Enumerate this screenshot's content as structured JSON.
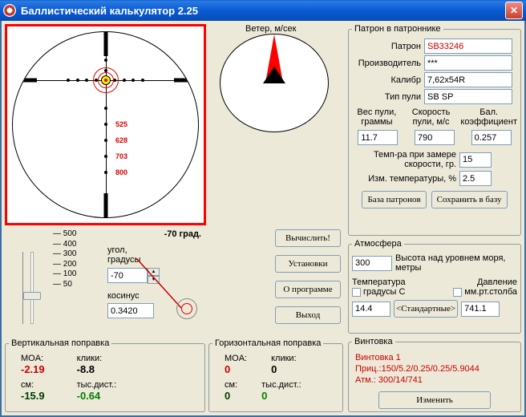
{
  "window": {
    "title": "Баллистический калькулятор 2.25"
  },
  "wind": {
    "label": "Ветер, м/сек"
  },
  "reticle": {
    "distances": [
      "525",
      "628",
      "703",
      "800"
    ]
  },
  "ammo": {
    "legend": "Патрон в патроннике",
    "cartridge_label": "Патрон",
    "cartridge": "SB33246",
    "maker_label": "Производитель",
    "maker": "***",
    "caliber_label": "Калибр",
    "caliber": "7,62x54R",
    "bullet_type_label": "Тип пули",
    "bullet_type": "SB SP",
    "weight_label": "Вес пули,\nграммы",
    "velocity_label": "Скорость\nпули, м/с",
    "bc_label": "Бал.\nкоэффициент",
    "weight": "11.7",
    "velocity": "790",
    "bc": "0.257",
    "temp_meas_label": "Темп-ра при замере\nскорости, гр.",
    "temp_meas": "15",
    "temp_delta_label": "Изм. температуры, %",
    "temp_delta": "2.5",
    "db_btn": "База патронов",
    "save_btn": "Сохранить в базу"
  },
  "scale": {
    "ticks": [
      "— 500",
      "— 400",
      "— 300",
      "— 200",
      "— 100",
      "— 50"
    ]
  },
  "angle": {
    "label": "угол,\nградусы",
    "value_header": "-70 град.",
    "value": "-70",
    "cos_label": "косинус",
    "cos": "0.3420"
  },
  "actions": {
    "calc": "Вычислить!",
    "settings": "Установки",
    "about": "О программе",
    "exit": "Выход"
  },
  "atm": {
    "legend": "Атмосфера",
    "alt": "300",
    "alt_label": "Высота над уровнем моря,\nметры",
    "temp_group": "Температура",
    "temp_unit": "градусы С",
    "pressure_group": "Давление",
    "pressure_unit": "мм.рт.столба",
    "temp": "14.4",
    "std_btn": "<Стандартные>",
    "pressure": "741.1"
  },
  "vcorr": {
    "legend": "Вертикальная поправка",
    "moa_lbl": "MOA:",
    "moa": "-2.19",
    "clicks_lbl": "клики:",
    "clicks": "-8.8",
    "cm_lbl": "см:",
    "cm": "-15.9",
    "dist_lbl": "тыс.дист.:",
    "dist": "-0.64"
  },
  "hcorr": {
    "legend": "Горизонтальная поправка",
    "moa_lbl": "MOA:",
    "moa": "0",
    "clicks_lbl": "клики:",
    "clicks": "0",
    "cm_lbl": "см:",
    "cm": "0",
    "dist_lbl": "тыс.дист.:",
    "dist": "0"
  },
  "rifle": {
    "legend": "Винтовка",
    "name": "Винтовка 1",
    "scope": "Приц.:150/5.2/0.25/0.25/5.9044",
    "atm": "Атм.:  300/14/741",
    "edit_btn": "Изменить"
  }
}
